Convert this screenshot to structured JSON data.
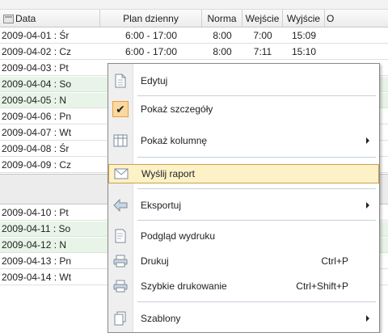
{
  "grid": {
    "columns": [
      "Data",
      "Plan dzienny",
      "Norma",
      "Wejście",
      "Wyjście",
      "O"
    ],
    "rows_a": [
      {
        "date": "2009-04-01 : Śr",
        "plan": "6:00 - 17:00",
        "norma": "8:00",
        "wej": "7:00",
        "wyj": "15:09",
        "weekend": false
      },
      {
        "date": "2009-04-02 : Cz",
        "plan": "6:00 - 17:00",
        "norma": "8:00",
        "wej": "7:11",
        "wyj": "15:10",
        "weekend": false
      },
      {
        "date": "2009-04-03 : Pt",
        "plan": "",
        "norma": "",
        "wej": "",
        "wyj": "",
        "weekend": false
      },
      {
        "date": "2009-04-04 : So",
        "plan": "",
        "norma": "",
        "wej": "",
        "wyj": "",
        "weekend": true
      },
      {
        "date": "2009-04-05 : N",
        "plan": "",
        "norma": "",
        "wej": "",
        "wyj": "",
        "weekend": true
      },
      {
        "date": "2009-04-06 : Pn",
        "plan": "",
        "norma": "",
        "wej": "",
        "wyj": "",
        "weekend": false
      },
      {
        "date": "2009-04-07 : Wt",
        "plan": "",
        "norma": "",
        "wej": "",
        "wyj": "",
        "weekend": false
      },
      {
        "date": "2009-04-08 : Śr",
        "plan": "",
        "norma": "",
        "wej": "",
        "wyj": "",
        "weekend": false
      },
      {
        "date": "2009-04-09 : Cz",
        "plan": "",
        "norma": "",
        "wej": "",
        "wyj": "",
        "weekend": false
      }
    ],
    "rows_b": [
      {
        "date": "2009-04-10 : Pt",
        "weekend": false
      },
      {
        "date": "2009-04-11 : So",
        "weekend": true
      },
      {
        "date": "2009-04-12 : N",
        "weekend": true
      },
      {
        "date": "2009-04-13 : Pn",
        "weekend": false
      },
      {
        "date": "2009-04-14 : Wt",
        "weekend": false
      }
    ]
  },
  "context_menu": {
    "items": [
      {
        "label": "Edytuj",
        "shortcut": "",
        "submenu": false,
        "icon": "edit-icon"
      },
      {
        "label": "Pokaż szczegóły",
        "shortcut": "",
        "submenu": false,
        "icon": "check-icon",
        "checked": true
      },
      {
        "label": "Pokaż kolumnę",
        "shortcut": "",
        "submenu": true,
        "icon": "columns-icon"
      },
      {
        "label": "Wyślij raport",
        "shortcut": "",
        "submenu": false,
        "icon": "envelope-icon",
        "highlighted": true
      },
      {
        "label": "Eksportuj",
        "shortcut": "",
        "submenu": true,
        "icon": "export-arrow-icon"
      },
      {
        "label": "Podgląd wydruku",
        "shortcut": "",
        "submenu": false,
        "icon": "print-preview-icon"
      },
      {
        "label": "Drukuj",
        "shortcut": "Ctrl+P",
        "submenu": false,
        "icon": "printer-icon"
      },
      {
        "label": "Szybkie drukowanie",
        "shortcut": "Ctrl+Shift+P",
        "submenu": false,
        "icon": "quick-print-icon"
      },
      {
        "label": "Szablony",
        "shortcut": "",
        "submenu": true,
        "icon": "templates-icon"
      }
    ]
  }
}
